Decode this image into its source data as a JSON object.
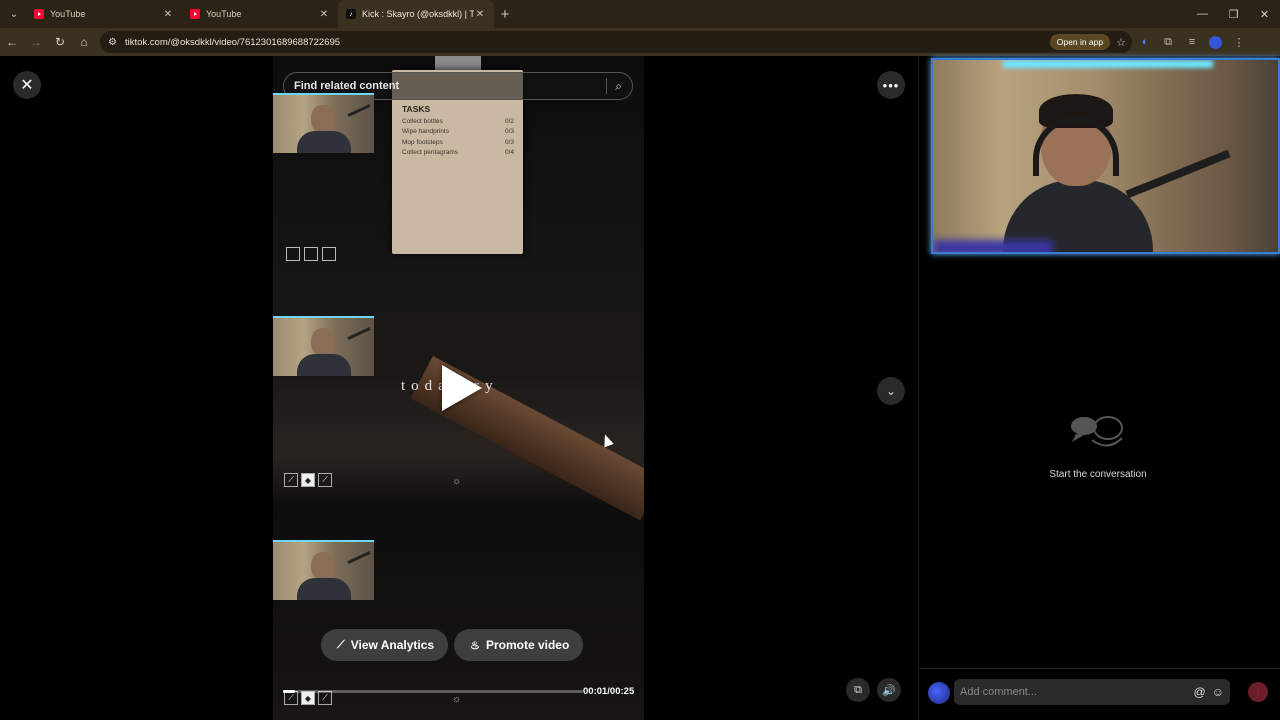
{
  "browser": {
    "tabs": [
      {
        "title": "YouTube",
        "favicon": "youtube-icon",
        "active": false
      },
      {
        "title": "YouTube",
        "favicon": "youtube-icon",
        "active": false
      },
      {
        "title": "Kick : Skayro (@oksdkkl) | TikTo",
        "favicon": "tiktok-icon",
        "active": true
      }
    ],
    "url": "tiktok.com/@oksdkkl/video/7612301689688722695",
    "open_in_app_label": "Open in app"
  },
  "video": {
    "search_placeholder": "Find related content",
    "tasks_title": "TASKS",
    "tasks": [
      {
        "name": "Collect bottles",
        "progress": "0/2"
      },
      {
        "name": "Wipe handprints",
        "progress": "0/3"
      },
      {
        "name": "Mop footsteps",
        "progress": "0/3"
      },
      {
        "name": "Collect pentagrams",
        "progress": "0/4"
      }
    ],
    "overlay_text": "toda    ory",
    "view_analytics_label": "View Analytics",
    "promote_video_label": "Promote video",
    "time_label": "00:01/00:25",
    "progress_fraction": 0.04
  },
  "comments": {
    "empty_message": "Start the conversation",
    "add_comment_placeholder": "Add comment..."
  },
  "colors": {
    "accent": "#fe2c55",
    "chrome_bg": "#3b3120"
  }
}
